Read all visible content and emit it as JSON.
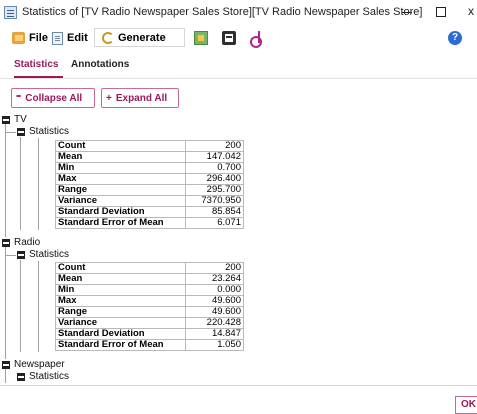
{
  "window": {
    "title": "Statistics of [TV Radio Newspaper Sales Store][TV Radio Newspaper Sales Store]",
    "close_glyph": "x"
  },
  "menu": {
    "file": "File",
    "edit": "Edit",
    "generate": "Generate",
    "help_glyph": "?"
  },
  "tabs": {
    "statistics": "Statistics",
    "annotations": "Annotations"
  },
  "buttons": {
    "collapse": "Collapse All",
    "collapse_glyph": "⁼",
    "expand": "Expand All",
    "expand_glyph": "+"
  },
  "tree": {
    "tv": {
      "label": "TV",
      "section": "Statistics",
      "rows": [
        {
          "k": "Count",
          "v": "200"
        },
        {
          "k": "Mean",
          "v": "147.042"
        },
        {
          "k": "Min",
          "v": "0.700"
        },
        {
          "k": "Max",
          "v": "296.400"
        },
        {
          "k": "Range",
          "v": "295.700"
        },
        {
          "k": "Variance",
          "v": "7370.950"
        },
        {
          "k": "Standard Deviation",
          "v": "85.854"
        },
        {
          "k": "Standard Error of Mean",
          "v": "6.071"
        }
      ]
    },
    "radio": {
      "label": "Radio",
      "section": "Statistics",
      "rows": [
        {
          "k": "Count",
          "v": "200"
        },
        {
          "k": "Mean",
          "v": "23.264"
        },
        {
          "k": "Min",
          "v": "0.000"
        },
        {
          "k": "Max",
          "v": "49.600"
        },
        {
          "k": "Range",
          "v": "49.600"
        },
        {
          "k": "Variance",
          "v": "220.428"
        },
        {
          "k": "Standard Deviation",
          "v": "14.847"
        },
        {
          "k": "Standard Error of Mean",
          "v": "1.050"
        }
      ]
    },
    "newspaper": {
      "label": "Newspaper",
      "section": "Statistics"
    }
  },
  "footer": {
    "ok": "OK"
  }
}
